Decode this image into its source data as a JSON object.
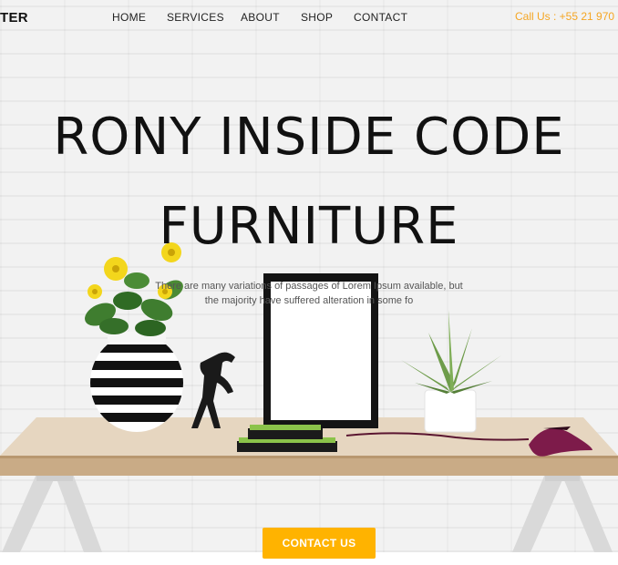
{
  "header": {
    "logo": "TER",
    "nav": [
      "HOME",
      "SERVICES",
      "ABOUT",
      "SHOP",
      "CONTACT"
    ],
    "phone": "Call Us : +55 21 970"
  },
  "hero": {
    "title_line1": "RONY INSIDE CODE",
    "title_line2": "FURNITURE",
    "subtitle_line1": "There are many variations of passages of Lorem Ipsum available, but",
    "subtitle_line2": "the majority have suffered alteration in some fo",
    "cta_label": "CONTACT US"
  },
  "colors": {
    "accent": "#ffb300",
    "phone": "#f5a623",
    "text": "#111111"
  }
}
